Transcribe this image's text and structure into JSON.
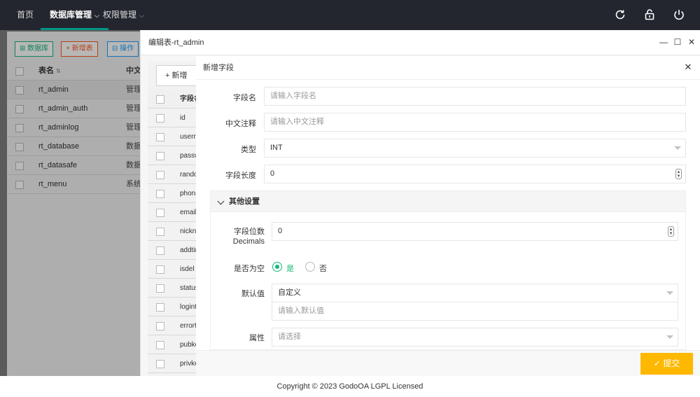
{
  "topbar": {
    "nav": [
      "首页",
      "数据库管理",
      "权限管理"
    ],
    "icons": [
      "refresh-icon",
      "lock-icon",
      "power-icon"
    ]
  },
  "background": {
    "buttons": [
      "数据库",
      "新增表",
      "操作"
    ],
    "columns": [
      "表名",
      "中文"
    ],
    "rows": [
      {
        "name": "rt_admin",
        "comment": "管理"
      },
      {
        "name": "rt_admin_auth",
        "comment": "管理"
      },
      {
        "name": "rt_adminlog",
        "comment": "管理"
      },
      {
        "name": "rt_database",
        "comment": "数据"
      },
      {
        "name": "rt_datasafe",
        "comment": "数据"
      },
      {
        "name": "rt_menu",
        "comment": "系统"
      }
    ]
  },
  "window": {
    "title": "编辑表-rt_admin",
    "add_label": "新增",
    "field_header": "字段名",
    "fields": [
      "id",
      "username",
      "password",
      "random",
      "phone",
      "email",
      "nickname",
      "addtime",
      "isdel",
      "status",
      "logintime",
      "errortime",
      "pubkey",
      "privkey"
    ]
  },
  "dialog": {
    "title": "新增字段",
    "field_name_label": "字段名",
    "field_name_placeholder": "请输入字段名",
    "comment_label": "中文注释",
    "comment_placeholder": "请输入中文注释",
    "type_label": "类型",
    "type_value": "INT",
    "length_label": "字段长度",
    "length_value": "0",
    "other_settings": "其他设置",
    "decimals_label_1": "字段位数",
    "decimals_label_2": "Decimals",
    "decimals_value": "0",
    "nullable_label": "是否为空",
    "yes": "是",
    "no": "否",
    "default_label": "默认值",
    "default_value": "自定义",
    "default_placeholder": "请输入默认值",
    "attr_label": "属性",
    "attr_placeholder": "请选择",
    "submit": "提交"
  },
  "footer": {
    "copyright": "Copyright © 2023 GodoOA LGPL Licensed"
  },
  "colors": {
    "accent": "#16b777",
    "submit": "#ffb800",
    "topbar": "#23262e"
  }
}
